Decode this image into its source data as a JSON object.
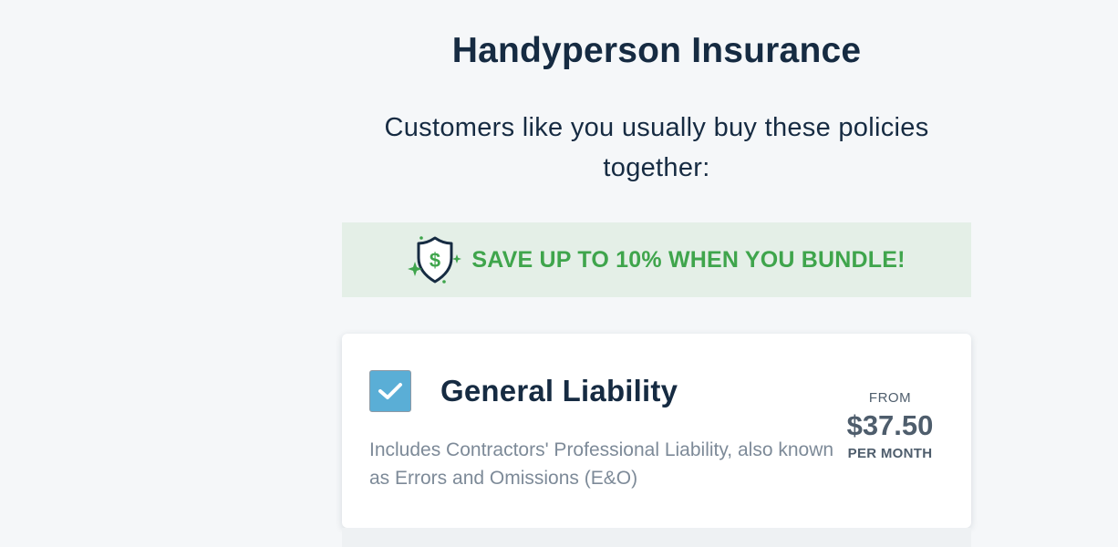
{
  "page": {
    "title": "Handyperson Insurance",
    "subtitle": "Customers like you usually buy these policies together:"
  },
  "bundle_banner": {
    "icon": "shield-dollar-icon",
    "text": "SAVE UP TO 10% WHEN YOU BUNDLE!",
    "accent_color": "#3fa54c",
    "background_color": "#e4efe7"
  },
  "policies": [
    {
      "name": "General Liability",
      "description": "Includes Contractors' Professional Liability, also known as Errors and Omissions (E&O)",
      "selected": true,
      "price_from_label": "FROM",
      "price": "$37.50",
      "price_period": "PER MONTH",
      "checkbox_color": "#5aaed6"
    }
  ]
}
